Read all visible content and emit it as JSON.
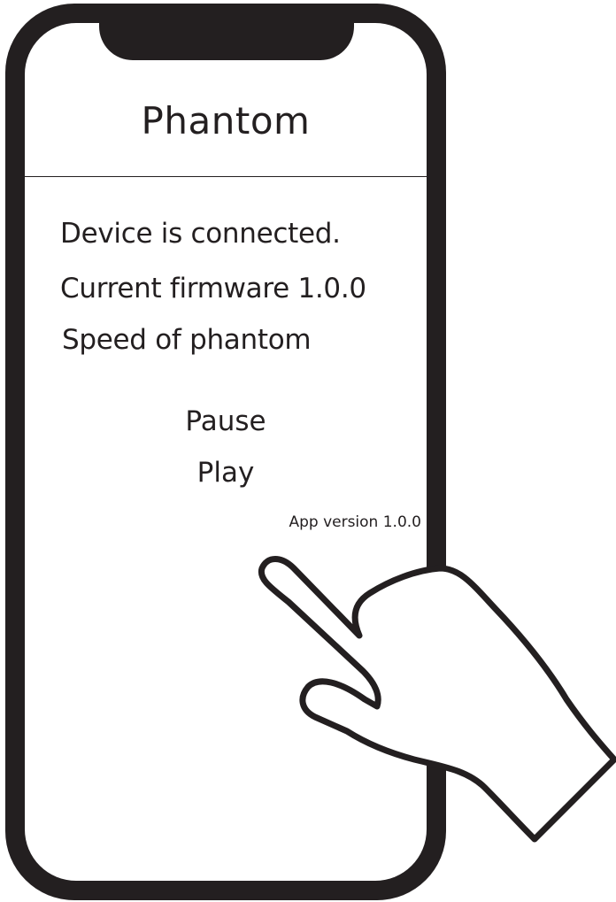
{
  "app": {
    "title": "Phantom"
  },
  "status": {
    "connection": "Device is connected.",
    "firmware": "Current firmware 1.0.0",
    "speed_label": "Speed of phantom"
  },
  "controls": {
    "pause_label": "Pause",
    "play_label": "Play"
  },
  "footer": {
    "app_version": "App version 1.0.0"
  },
  "icons": {
    "hand": "pointing-hand-icon"
  },
  "colors": {
    "frame": "#231f20",
    "screen": "#ffffff",
    "text": "#231f20"
  }
}
